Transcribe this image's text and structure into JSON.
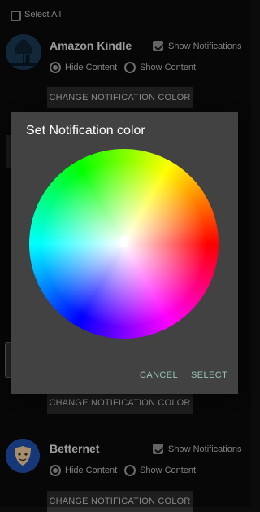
{
  "header": {
    "select_all_label": "Select All"
  },
  "apps": [
    {
      "name": "Amazon Kindle",
      "show_notifications_label": "Show Notifications",
      "hide_content_label": "Hide Content",
      "show_content_label": "Show Content",
      "change_color_label": "CHANGE NOTIFICATION COLOR"
    },
    {
      "change_color_label": "CHANGE NOTIFICATION COLOR"
    },
    {
      "name": "Betternet",
      "show_notifications_label": "Show Notifications",
      "hide_content_label": "Hide Content",
      "show_content_label": "Show Content",
      "change_color_label": "CHANGE NOTIFICATION COLOR"
    }
  ],
  "dialog": {
    "title": "Set Notification color",
    "cancel_label": "CANCEL",
    "select_label": "SELECT"
  },
  "icons": {
    "kindle": "reader-under-tree-icon",
    "betternet": "shield-face-icon"
  },
  "colors": {
    "background": "#0b0b0b",
    "dialog": "#424242",
    "button_text": "#98c4b8"
  }
}
